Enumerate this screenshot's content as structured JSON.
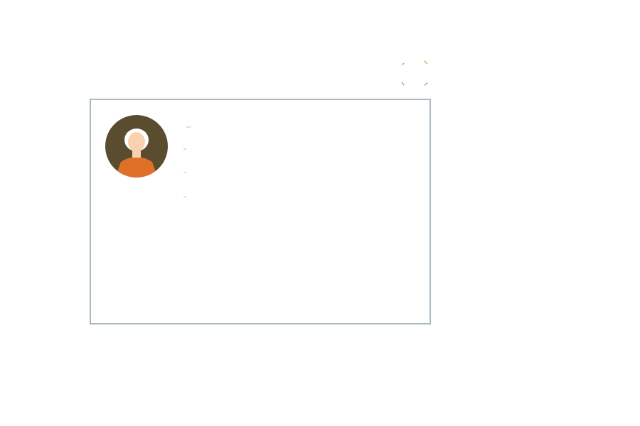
{
  "colors": {
    "card_border": "#a9b8c1",
    "avatar_ring": "#5a4c2e",
    "avatar_shirt": "#e07028",
    "avatar_skin": "#f8d2b0",
    "avatar_hair": "#ffffff",
    "marker_orange": "#e08a2a",
    "marker_blue": "#4a8ee0"
  },
  "icons": {
    "marker": "corner-brackets-icon",
    "avatar": "user-avatar-icon"
  },
  "card": {
    "title": "",
    "lines": [
      "",
      "",
      ""
    ]
  }
}
